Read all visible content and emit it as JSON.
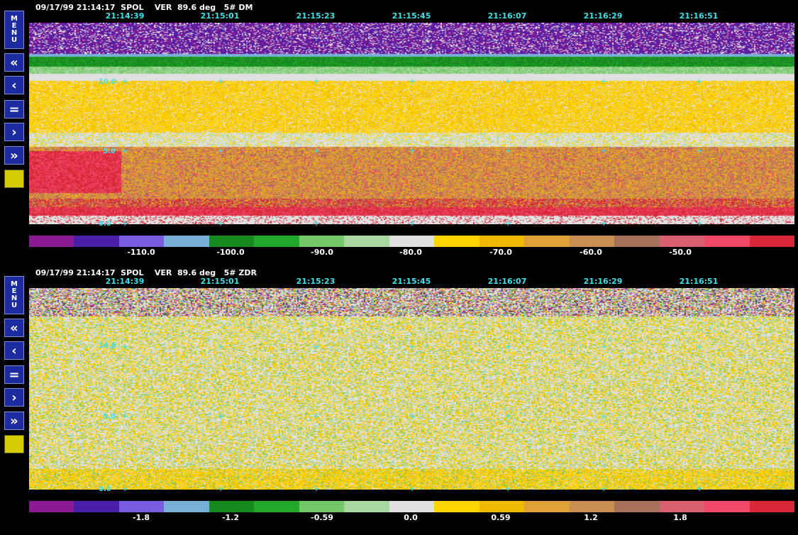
{
  "panels": [
    {
      "header": "09/17/99 21:14:17  SPOL    VER  89.6 deg   5# DM",
      "field": "DM",
      "times": [
        "21:14:39",
        "21:15:01",
        "21:15:23",
        "21:15:45",
        "21:16:07",
        "21:16:29",
        "21:16:51"
      ],
      "heights": [
        "10.0",
        "5.0",
        "0.0"
      ],
      "colorbar_labels": [
        "-110.0",
        "-100.0",
        "-90.0",
        "-80.0",
        "-70.0",
        "-60.0",
        "-50.0"
      ]
    },
    {
      "header": "09/17/99 21:14:17  SPOL    VER  89.6 deg   5# ZDR",
      "field": "ZDR",
      "times": [
        "21:14:39",
        "21:15:01",
        "21:15:23",
        "21:15:45",
        "21:16:07",
        "21:16:29",
        "21:16:51"
      ],
      "heights": [
        "10.0",
        "5.0",
        "0.0"
      ],
      "colorbar_labels": [
        "-1.8",
        "-1.2",
        "-0.59",
        "0.0",
        "0.59",
        "1.2",
        "1.8"
      ]
    }
  ],
  "sidebar": {
    "menu_letters": [
      "M",
      "E",
      "N",
      "U"
    ],
    "buttons": [
      "«",
      "‹",
      "=",
      "›",
      "»"
    ]
  },
  "colorbar_colors": [
    "#8a1a94",
    "#4a1fa8",
    "#7a5ce0",
    "#78b0d8",
    "#168a1e",
    "#22a82a",
    "#74c86a",
    "#a8d8a0",
    "#e0e0e0",
    "#ffd400",
    "#f0b800",
    "#e0a038",
    "#c89050",
    "#a87058",
    "#d86070",
    "#f04868",
    "#d82838"
  ]
}
